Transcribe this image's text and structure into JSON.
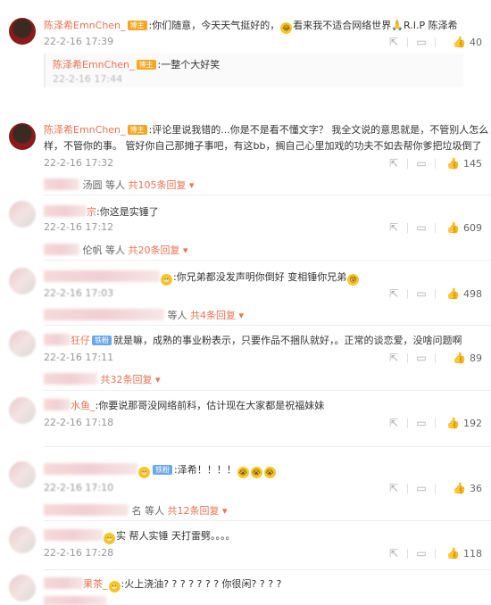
{
  "comments": [
    {
      "username": "陈泽希EmnChen_",
      "badge": "博主",
      "text": ":你们随意，今天天气挺好的，",
      "emoji": "😂",
      "text2": "看来我不适合网络世界",
      "emoji2": "🙏",
      "text3": "R.I.P 陈泽希",
      "time": "22-2-16 17:39",
      "likes": "40",
      "sub_reply": {
        "username": "陈泽希EmnChen_",
        "badge": "博主",
        "text": ":一整个大好笑",
        "time": "22-2-16 17:44"
      }
    },
    {
      "username": "陈泽希EmnChen_",
      "badge": "博主",
      "text": ":评论里说我错的...你是不是看不懂文字？ 我全文说的意思就是，不管别人怎么",
      "text_line2": "样，不管你的事。 管好你自己那摊子事吧，有这bb，搁自己心里加戏的功夫不如去帮你爹把垃圾倒了",
      "time": "22-2-16 17:32",
      "likes": "145",
      "replies_prefix": "汤圆 等人",
      "replies_link": "共105条回复"
    },
    {
      "username_partial": "宗",
      "text": ":你这是实锤了",
      "time": "22-2-16 17:12",
      "likes": "609",
      "replies_prefix": "伦帆 等人",
      "replies_link": "共20条回复"
    },
    {
      "text": ":你兄弟都没发声明你倒好 变相锤你兄弟",
      "time": "22-2-16 17:03",
      "likes": "498",
      "replies_prefix": "等人",
      "replies_link": "共4条回复"
    },
    {
      "username_partial": "狂仔",
      "badge": "铁粉",
      "text": "就是嘛，成熟的事业粉表示，只要作品不捆队就好，。正常的谈恋爱，没啥问题啊",
      "time": "22-2-16 17:11",
      "likes": "89",
      "replies_link": "共32条回复"
    },
    {
      "username_partial": "水鱼_",
      "text": ":你要说那哥没网络前科，估计现在大家都是祝福妹妹",
      "time": "22-2-16 17:18",
      "likes": "192"
    },
    {
      "badge": "铁粉",
      "text": ":泽希！！！！",
      "time": "22-2-16 17:10",
      "likes": "36",
      "replies_prefix": "名 等人",
      "replies_link": "共12条回复"
    },
    {
      "text": "实 帮人实锤 天打雷劈。。。。",
      "time": "22-2-16 17:28",
      "likes": "118"
    },
    {
      "username_partial": "果茶_",
      "text": ":火上浇油? ? ? ? ? ? ? 你很闲? ? ? ?"
    }
  ],
  "icons": {
    "share": "share-icon",
    "comment": "comment-icon",
    "like": "like-icon",
    "dropdown": "chevron-down-icon"
  }
}
